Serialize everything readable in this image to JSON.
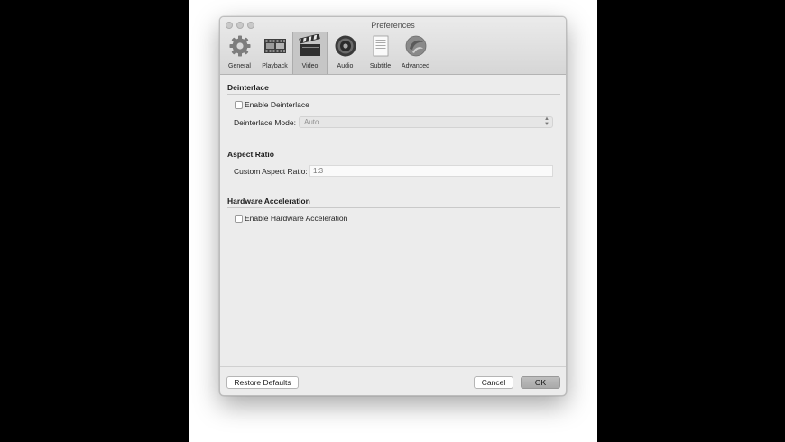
{
  "window": {
    "title": "Preferences"
  },
  "toolbar": {
    "items": [
      {
        "label": "General",
        "icon": "gear-icon"
      },
      {
        "label": "Playback",
        "icon": "film-strip-icon"
      },
      {
        "label": "Video",
        "icon": "clapperboard-icon",
        "active": true
      },
      {
        "label": "Audio",
        "icon": "speaker-icon"
      },
      {
        "label": "Subtitle",
        "icon": "document-icon"
      },
      {
        "label": "Advanced",
        "icon": "swirl-icon"
      }
    ]
  },
  "sections": {
    "deinterlace": {
      "title": "Deinterlace",
      "enable_label": "Enable Deinterlace",
      "enable_checked": false,
      "mode_label": "Deinterlace Mode:",
      "mode_value": "Auto"
    },
    "aspect_ratio": {
      "title": "Aspect Ratio",
      "custom_label": "Custom Aspect Ratio:",
      "custom_placeholder": "1:3"
    },
    "hardware": {
      "title": "Hardware Acceleration",
      "enable_label": "Enable Hardware Acceleration",
      "enable_checked": false
    }
  },
  "buttons": {
    "restore": "Restore Defaults",
    "cancel": "Cancel",
    "ok": "OK"
  }
}
